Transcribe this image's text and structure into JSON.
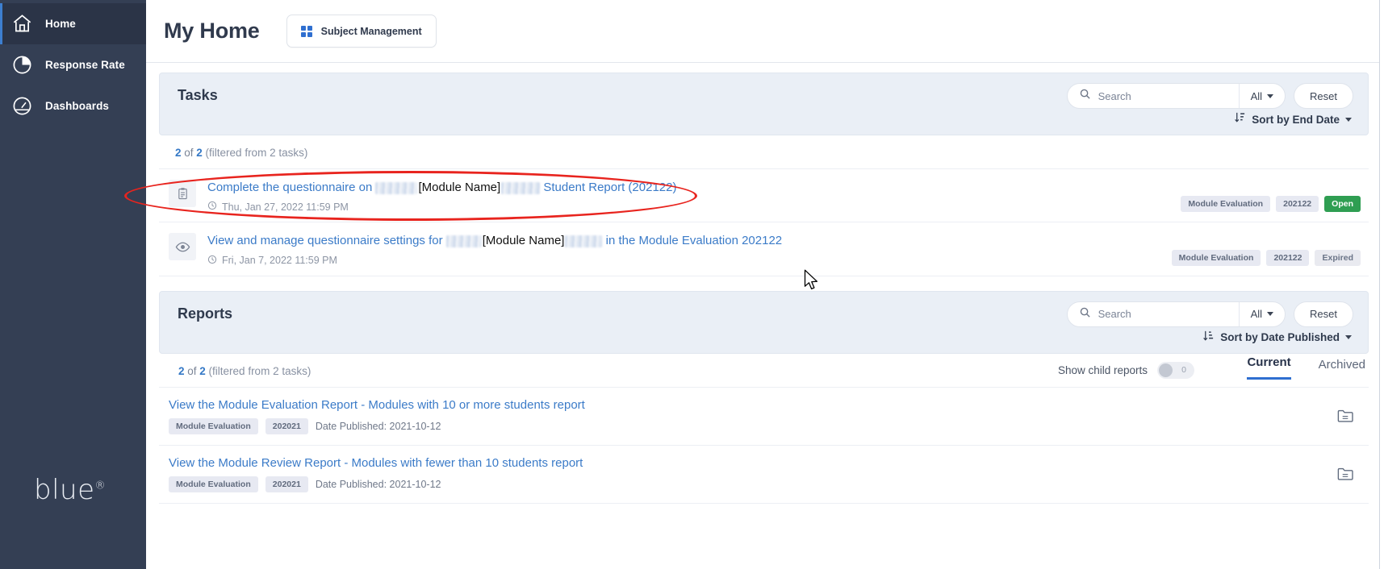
{
  "sidebar": {
    "items": [
      {
        "label": "Home",
        "icon": "home-icon",
        "active": true
      },
      {
        "label": "Response Rate",
        "icon": "pie-chart-icon",
        "active": false
      },
      {
        "label": "Dashboards",
        "icon": "gauge-icon",
        "active": false
      }
    ],
    "brand": "blue",
    "brand_mark": "®"
  },
  "header": {
    "title": "My Home",
    "subject_management_label": "Subject Management",
    "subject_management_icon": "grid-icon"
  },
  "tasks": {
    "title": "Tasks",
    "search_placeholder": "Search",
    "search_value": "",
    "search_icon": "search-icon",
    "filter_label": "All",
    "reset_label": "Reset",
    "sort_label": "Sort by End Date",
    "sort_icon": "sort-descending-icon",
    "count_prefix": "2",
    "count_mid": " of ",
    "count_total": "2",
    "count_suffix": " (filtered from 2 tasks)",
    "items": [
      {
        "icon": "clipboard-icon",
        "text_before": "Complete the questionnaire on ",
        "redacted_label": "[Module Name]",
        "text_after": " Student Report (202122)",
        "date_icon": "clock-icon",
        "date": "Thu, Jan 27, 2022 11:59 PM",
        "badges": [
          {
            "label": "Module Evaluation",
            "type": "tag"
          },
          {
            "label": "202122",
            "type": "tag"
          },
          {
            "label": "Open",
            "type": "status-open"
          }
        ]
      },
      {
        "icon": "eye-icon",
        "text_before": "View and manage questionnaire settings for ",
        "redacted_label": "[Module Name]",
        "text_after": " in the Module Evaluation 202122",
        "date_icon": "clock-icon",
        "date": "Fri, Jan 7, 2022 11:59 PM",
        "badges": [
          {
            "label": "Module Evaluation",
            "type": "tag"
          },
          {
            "label": "202122",
            "type": "tag"
          },
          {
            "label": "Expired",
            "type": "status-expired"
          }
        ]
      }
    ]
  },
  "reports": {
    "title": "Reports",
    "search_placeholder": "Search",
    "search_value": "",
    "search_icon": "search-icon",
    "filter_label": "All",
    "reset_label": "Reset",
    "sort_label": "Sort by Date Published",
    "sort_icon": "sort-ascending-icon",
    "count_prefix": "2",
    "count_mid": " of ",
    "count_total": "2",
    "count_suffix": " (filtered from 2 tasks)",
    "show_child_label": "Show child reports",
    "show_child_value": "0",
    "show_child_on": false,
    "tabs": [
      {
        "label": "Current",
        "active": true
      },
      {
        "label": "Archived",
        "active": false
      }
    ],
    "items": [
      {
        "link": "View the Module Evaluation Report - Modules with 10 or more students report",
        "tags": [
          "Module Evaluation",
          "202021"
        ],
        "date": "Date Published: 2021-10-12",
        "action_icon": "report-folder-icon"
      },
      {
        "link": "View the Module Review Report - Modules with fewer than 10 students report",
        "tags": [
          "Module Evaluation",
          "202021"
        ],
        "date": "Date Published: 2021-10-12",
        "action_icon": "report-folder-icon"
      }
    ]
  },
  "annotation": {
    "shape": "red-ellipse-highlight"
  },
  "colors": {
    "sidebar_bg": "#343f54",
    "accent_blue": "#2f6fd0",
    "link_blue": "#3b7bc8",
    "status_open_green": "#2f9e52",
    "annotation_red": "#e8241e",
    "panel_bg": "#eaeff6"
  }
}
